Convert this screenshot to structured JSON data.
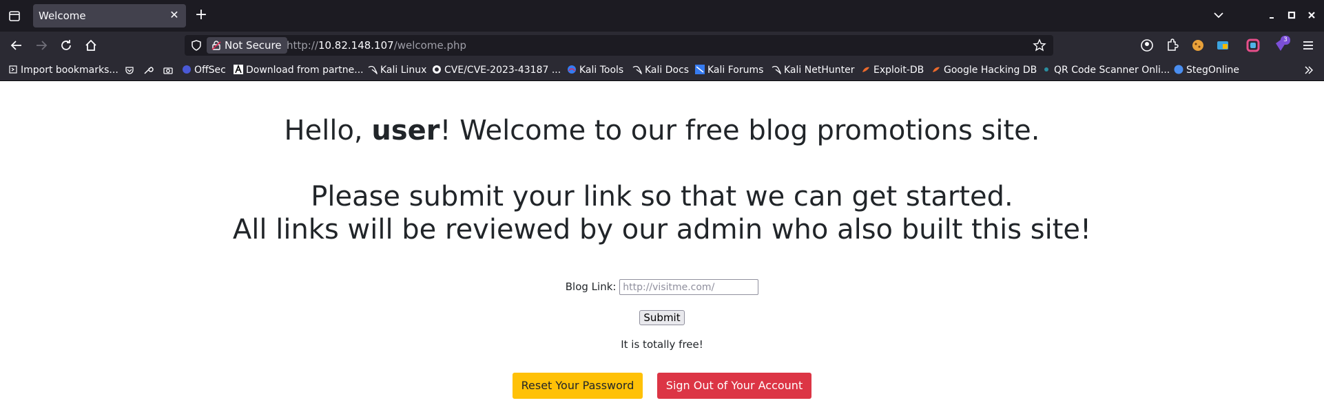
{
  "browser": {
    "tab_title": "Welcome",
    "tab_close": "✕",
    "new_tab": "+",
    "security_label": "Not Secure",
    "url_scheme": "http://",
    "url_host": "10.82.148.107",
    "url_path": "/welcome.php",
    "extensions_badge": "3"
  },
  "bookmarks": [
    "Import bookmarks...",
    "OffSec",
    "Download from partne...",
    "Kali Linux",
    "CVE/CVE-2023-43187 ...",
    "Kali Tools",
    "Kali Docs",
    "Kali Forums",
    "Kali NetHunter",
    "Exploit-DB",
    "Google Hacking DB",
    "QR Code Scanner Onli...",
    "StegOnline"
  ],
  "page": {
    "greeting_prefix": "Hello, ",
    "username": "user",
    "greeting_suffix": "! Welcome to our free blog promotions site.",
    "line2": "Please submit your link so that we can get started.",
    "line3": "All links will be reviewed by our admin who also built this site!",
    "blog_link_label": "Blog Link:",
    "blog_link_placeholder": "http://visitme.com/",
    "blog_link_value": "",
    "submit_label": "Submit",
    "free_note": "It is totally free!",
    "reset_password_label": "Reset Your Password",
    "sign_out_label": "Sign Out of Your Account"
  },
  "colors": {
    "warning": "#ffc107",
    "danger": "#dc3545",
    "text": "#212529"
  }
}
